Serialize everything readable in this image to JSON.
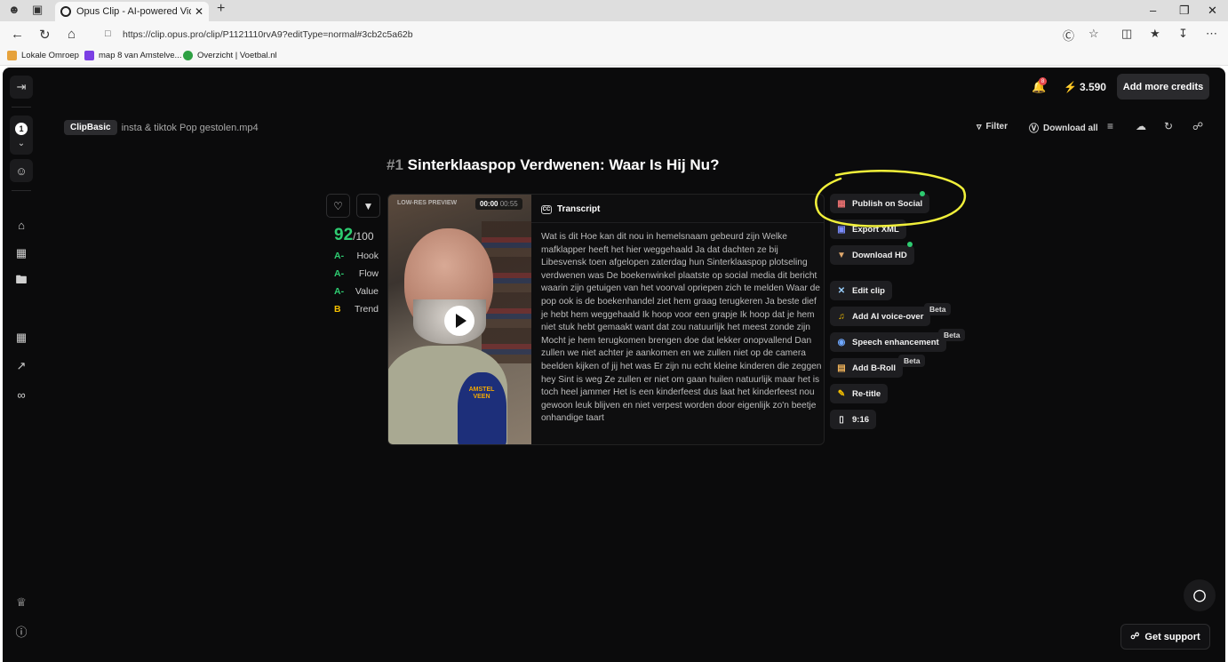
{
  "browser": {
    "tab_title": "Opus Clip - AI-powered Video Re",
    "url": "https://clip.opus.pro/clip/P1121110rvA9?editType=normal#3cb2c5a62b",
    "bookmarks": [
      {
        "label": "Lokale Omroep",
        "color": "#e6a23c"
      },
      {
        "label": "map 8 van Amstelve...",
        "color": "#7b3fe4"
      },
      {
        "label": "Overzicht | Voetbal.nl",
        "color": "#2ea043"
      }
    ]
  },
  "header": {
    "notification_count": "8",
    "credits": "3.590",
    "add_credits_label": "Add more credits"
  },
  "sidebar": {
    "page_number": "1"
  },
  "breadcrumb": {
    "pill": "ClipBasic",
    "filename": "insta & tiktok Pop gestolen.mp4"
  },
  "toolbar": {
    "filter_label": "Filter",
    "download_all_label": "Download all"
  },
  "clip": {
    "number": "#1",
    "title": "Sinterklaaspop Verdwenen: Waar Is Hij Nu?",
    "score": "92",
    "score_max": "/100",
    "grades": [
      {
        "grade": "A-",
        "label": "Hook",
        "color": "#2ecc71"
      },
      {
        "grade": "A-",
        "label": "Flow",
        "color": "#2ecc71"
      },
      {
        "grade": "A-",
        "label": "Value",
        "color": "#2ecc71"
      },
      {
        "grade": "B",
        "label": "Trend",
        "color": "#f5c000"
      }
    ],
    "video": {
      "watermark": "LOW-RES PREVIEW",
      "time_current": "00:00",
      "time_total": "00:55",
      "mic_logo": "AMSTEL VEEN"
    },
    "transcript_label": "Transcript",
    "transcript": "Wat is dit Hoe kan dit nou in hemelsnaam gebeurd zijn Welke mafklapper heeft het hier weggehaald Ja dat dachten ze bij Libesvensk toen afgelopen zaterdag hun Sinterklaaspop plotseling verdwenen was De boekenwinkel plaatste op social media dit bericht waarin zijn getuigen van het voorval opriepen zich te melden Waar de pop ook is de boekenhandel ziet hem graag terugkeren Ja beste dief je hebt hem weggehaald Ik hoop voor een grapje Ik hoop dat je hem niet stuk hebt gemaakt want dat zou natuurlijk het meest zonde zijn Mocht je hem terugkomen brengen doe dat lekker onopvallend Dan zullen we niet achter je aankomen en we zullen niet op de camera beelden kijken of jij het was Er zijn nu echt kleine kinderen die zeggen hey Sint is weg Ze zullen er niet om gaan huilen natuurlijk maar het is toch heel jammer Het is een kinderfeest dus laat het kinderfeest nou gewoon leuk blijven en niet verpest worden door eigenlijk zo'n beetje onhandige taart"
  },
  "actions": {
    "publish": "Publish on Social",
    "export_xml": "Export XML",
    "download_hd": "Download HD",
    "edit_clip": "Edit clip",
    "voice_over": "Add AI voice-over",
    "speech": "Speech enhancement",
    "broll": "Add B-Roll",
    "retitle": "Re-title",
    "ratio": "9:16",
    "beta_label": "Beta"
  },
  "support": {
    "label": "Get support"
  },
  "colors": {
    "highlight": "#f1f03a",
    "accent_green": "#2ecc71",
    "app_bg": "#0b0b0c"
  }
}
